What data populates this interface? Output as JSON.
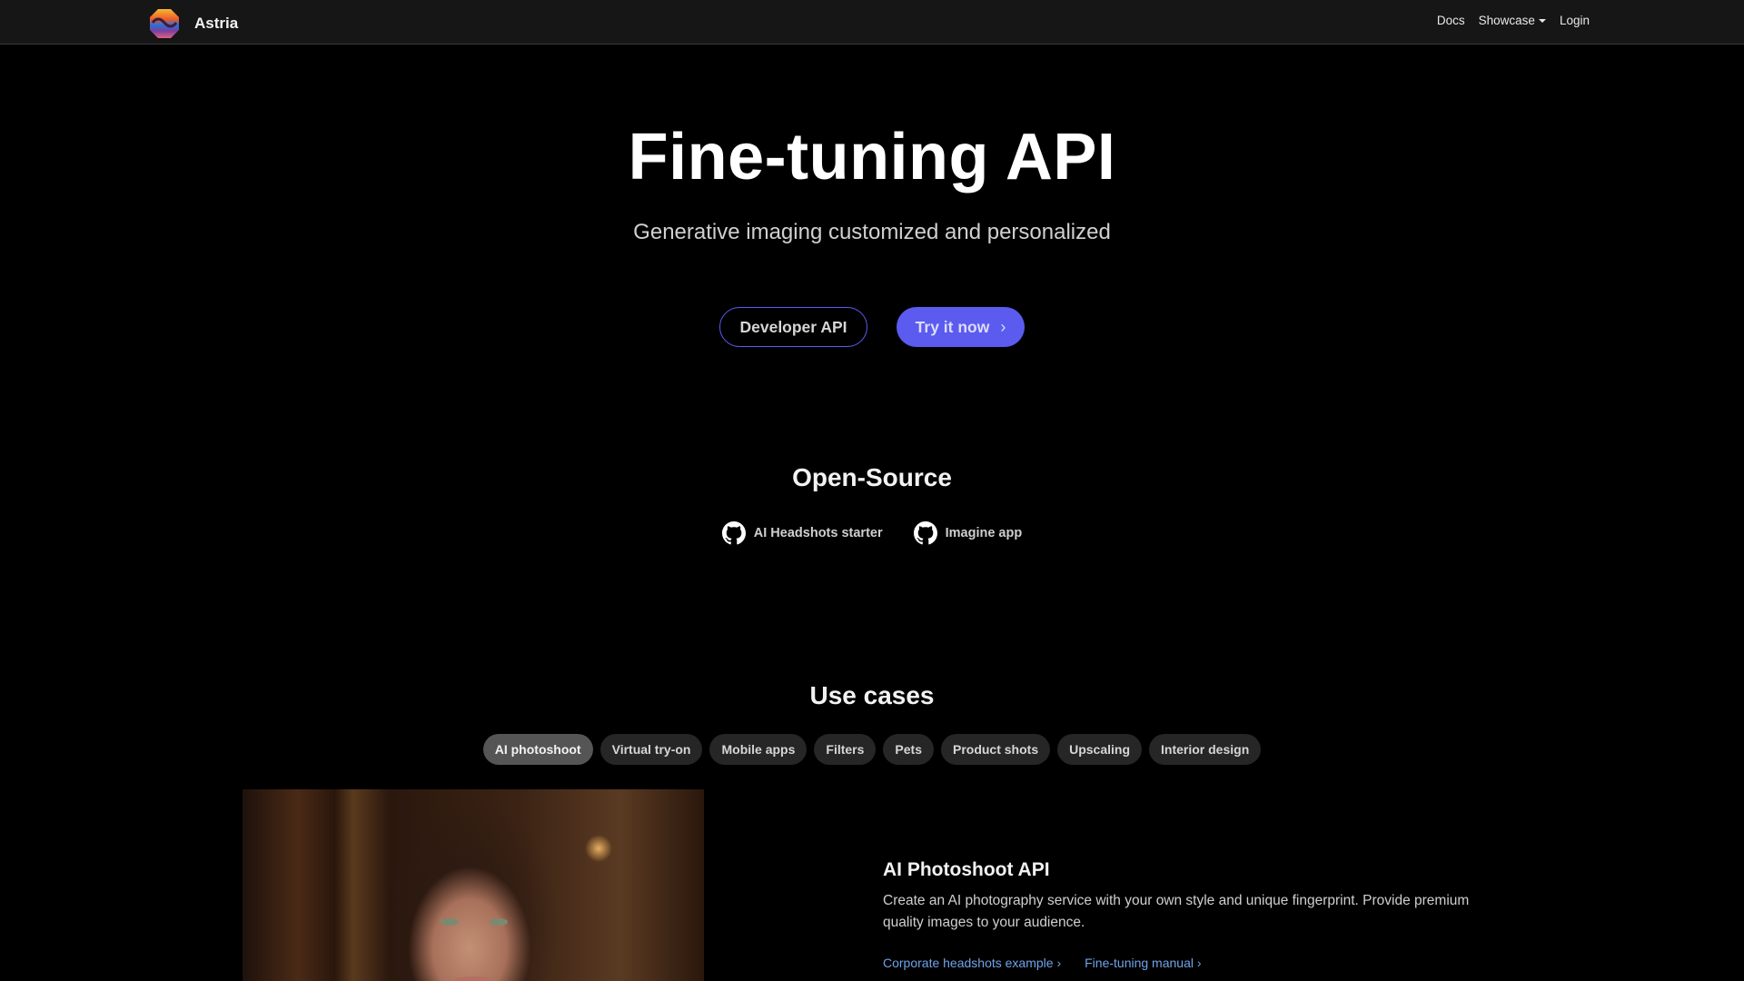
{
  "header": {
    "brand": "Astria",
    "nav": [
      {
        "label": "Docs"
      },
      {
        "label": "Showcase",
        "has_dropdown": true
      },
      {
        "label": "Login"
      }
    ]
  },
  "hero": {
    "title": "Fine-tuning API",
    "subtitle": "Generative imaging customized and personalized",
    "buttons": {
      "secondary": "Developer API",
      "primary": "Try it now"
    },
    "accent_color": "#5b5bf0"
  },
  "open_source": {
    "title": "Open-Source",
    "links": [
      {
        "label": "AI Headshots starter",
        "icon": "github-icon"
      },
      {
        "label": "Imagine app",
        "icon": "github-icon"
      }
    ]
  },
  "use_cases": {
    "title": "Use cases",
    "tabs": [
      {
        "label": "AI photoshoot",
        "active": true
      },
      {
        "label": "Virtual try-on"
      },
      {
        "label": "Mobile apps"
      },
      {
        "label": "Filters"
      },
      {
        "label": "Pets"
      },
      {
        "label": "Product shots"
      },
      {
        "label": "Upscaling"
      },
      {
        "label": "Interior design"
      }
    ],
    "card": {
      "title": "AI Photoshoot API",
      "description": "Create an AI photography service with your own style and unique fingerprint. Provide premium quality images to your audience.",
      "links": [
        {
          "label": "Corporate headshots example"
        },
        {
          "label": "Fine-tuning manual"
        }
      ],
      "link_color": "#6fa3e8"
    }
  }
}
